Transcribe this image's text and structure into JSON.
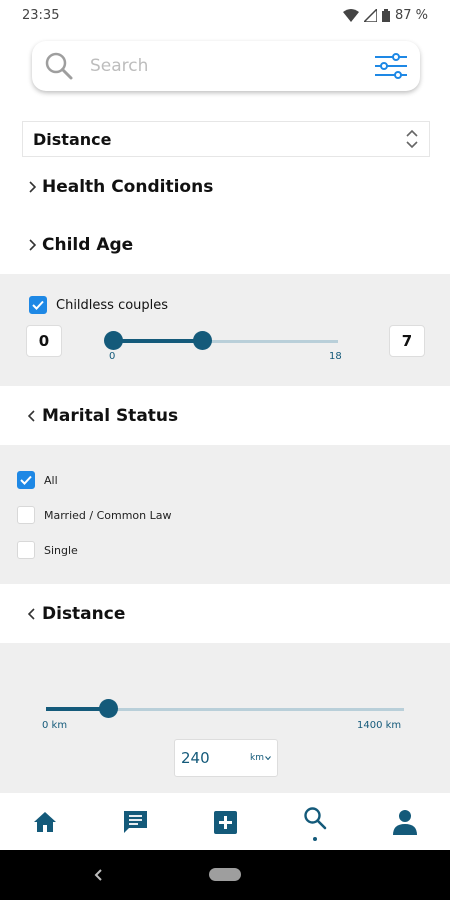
{
  "status_bar": {
    "time": "23:35",
    "battery": "87 %"
  },
  "search": {
    "placeholder": "Search"
  },
  "sort": {
    "selected": "Distance"
  },
  "sections": {
    "health": "Health Conditions",
    "child_age": "Child Age",
    "marital": "Marital Status",
    "distance": "Distance"
  },
  "child_age": {
    "childless_label": "Childless couples",
    "childless_checked": true,
    "min_value": "0",
    "max_value": "7",
    "range_min_label": "0",
    "range_max_label": "18",
    "range_min": 0,
    "range_max": 18,
    "selected_low": 0,
    "selected_high": 7
  },
  "marital": {
    "options": [
      {
        "label": "All",
        "checked": true
      },
      {
        "label": "Married / Common Law",
        "checked": false
      },
      {
        "label": "Single",
        "checked": false
      }
    ]
  },
  "distance": {
    "min_label": "0 km",
    "max_label": "1400 km",
    "range_min": 0,
    "range_max": 1400,
    "value": "240",
    "unit": "km"
  },
  "bottom_nav": [
    "home",
    "messages",
    "add",
    "search",
    "profile"
  ],
  "colors": {
    "accent": "#145a7a",
    "checkbox": "#1e88e5",
    "panel_bg": "#efefef"
  }
}
